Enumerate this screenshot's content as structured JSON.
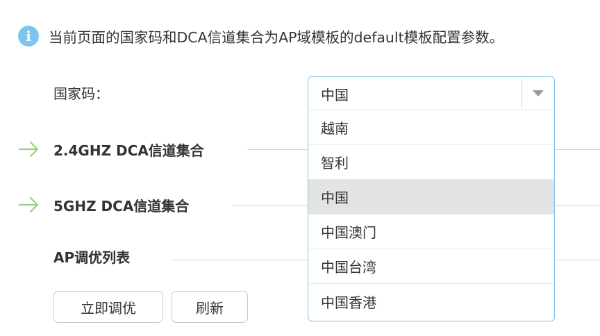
{
  "info": {
    "icon": "info-icon",
    "text": "当前页面的国家码和DCA信道集合为AP域模板的default模板配置参数。"
  },
  "country_code": {
    "label": "国家码：",
    "selected": "中国",
    "options": [
      "越南",
      "智利",
      "中国",
      "中国澳门",
      "中国台湾",
      "中国香港"
    ]
  },
  "sections": {
    "dca_24": "2.4GHZ DCA信道集合",
    "dca_5": "5GHZ DCA信道集合",
    "ap_tune_list": "AP调优列表"
  },
  "buttons": {
    "tune_now": "立即调优",
    "refresh": "刷新"
  },
  "colors": {
    "accent": "#7ec3ea",
    "arrow": "#8fd37a",
    "selected_bg": "#e3e3e3"
  }
}
